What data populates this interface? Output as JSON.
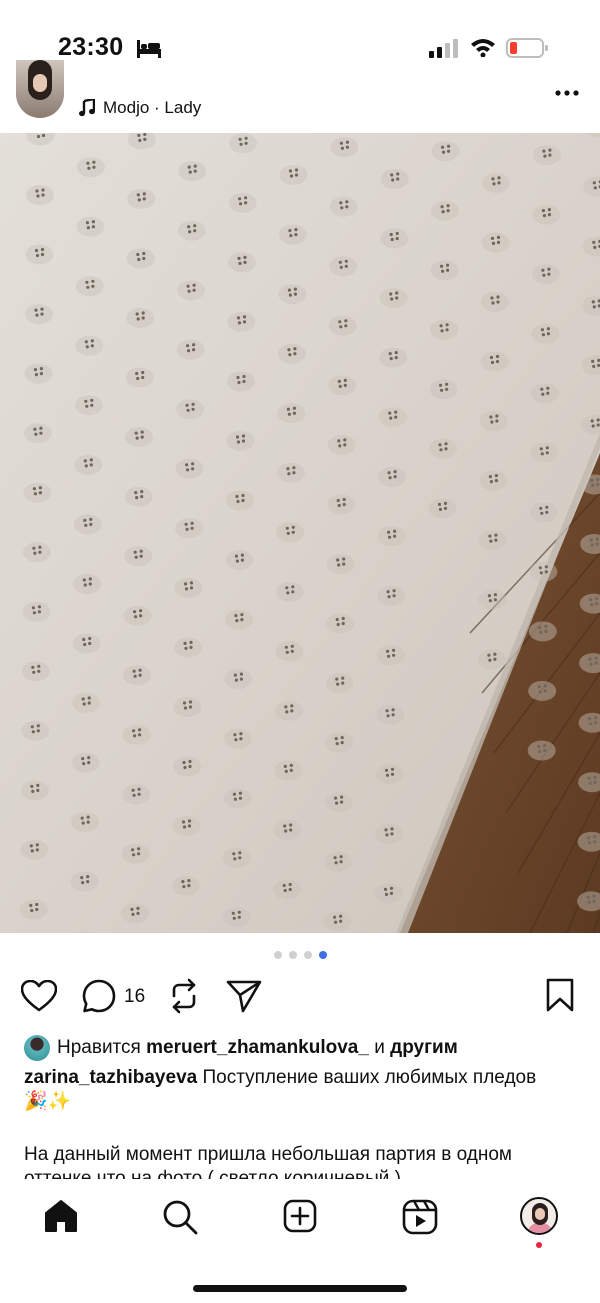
{
  "status_bar": {
    "time": "23:30",
    "icons": [
      "bed-icon",
      "signal-icon",
      "wifi-icon",
      "battery-low-icon"
    ],
    "battery_color": "#ff3b30"
  },
  "post_header": {
    "audio_label": "Modjo · Lady",
    "icons": [
      "music-note-icon",
      "more-icon"
    ]
  },
  "media": {
    "slide_count": 4,
    "active_slide": 4,
    "volume_icon": "speaker-icon"
  },
  "actions": {
    "comment_count": "16",
    "icons": [
      "heart-icon",
      "comment-icon",
      "repost-icon",
      "share-icon",
      "bookmark-icon"
    ]
  },
  "likes": {
    "prefix": "Нравится",
    "user": "meruert_zhamankulova_",
    "conjunction": "и",
    "suffix": "другим"
  },
  "caption": {
    "username": "zarina_tazhibayeva",
    "text": "Поступление ваших любимых пледов 🎉✨",
    "body": "На данный момент пришла небольшая партия в одном оттенке что на фото ( светло коричневый )"
  },
  "nav": {
    "items": [
      "home-icon",
      "search-icon",
      "create-icon",
      "reels-icon",
      "profile-avatar"
    ],
    "accent": "#3f6fe6",
    "notification_color": "#e8243c"
  }
}
